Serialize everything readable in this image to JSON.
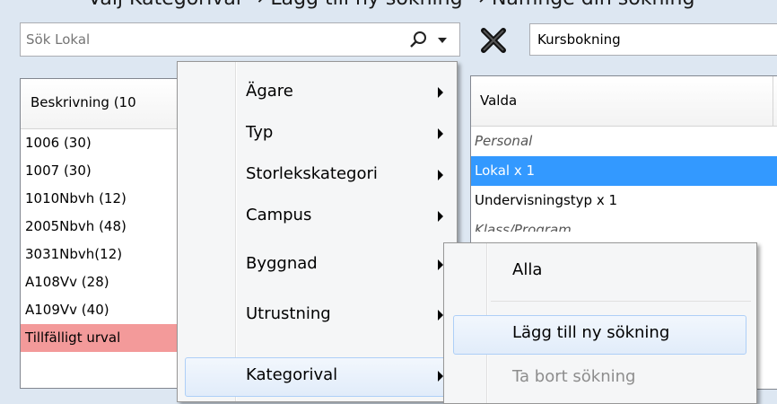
{
  "caption": "Välj Kategorival → Lägg till ny sökning → Namnge din sökning",
  "search": {
    "placeholder": "Sök Lokal",
    "icon": "search-icon"
  },
  "category": {
    "value": "Kursbokning"
  },
  "list": {
    "header": "Beskrivning (10",
    "rows": [
      "1006 (30)",
      "1007 (30)",
      "1010Nbvh (12)",
      "2005Nbvh (48)",
      "3031Nbvh(12)",
      "A108Vv (28)",
      "A109Vv (40)",
      "Tillfälligt urval"
    ]
  },
  "selected": {
    "header": "Valda",
    "rows": [
      "Personal",
      "Lokal x 1",
      "Undervisningstyp x 1",
      "Klass/Program"
    ]
  },
  "context_menu": {
    "items": [
      "Ägare",
      "Typ",
      "Storlekskategori",
      "Campus",
      "Byggnad",
      "Utrustning",
      "Kategorival"
    ]
  },
  "submenu": {
    "items": [
      "Alla",
      "Lägg till ny sökning",
      "Ta bort sökning"
    ]
  },
  "colors": {
    "highlight": "#3399ff",
    "temp_row": "#f39a9a",
    "background": "#dde7f2"
  }
}
